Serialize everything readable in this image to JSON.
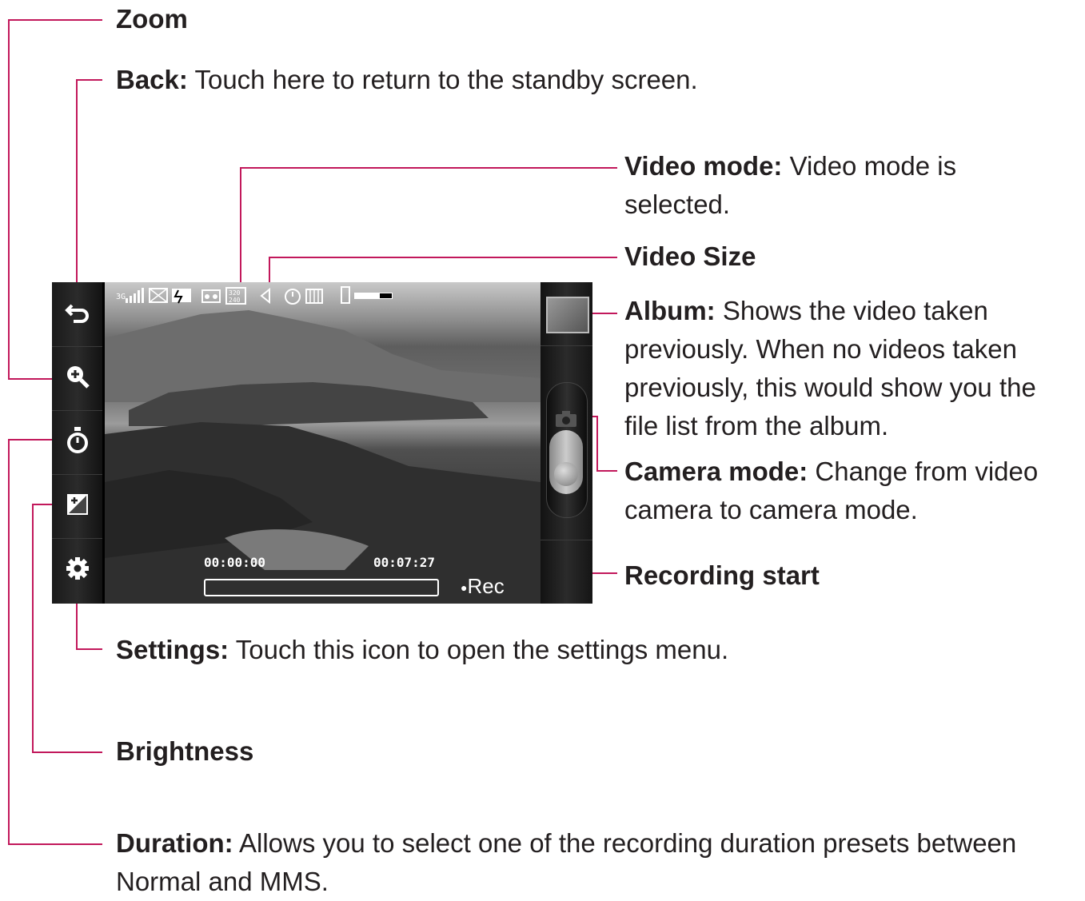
{
  "callouts": {
    "zoom": {
      "title": "Zoom",
      "desc": ""
    },
    "back": {
      "title": "Back:",
      "desc": " Touch here to return to the standby screen."
    },
    "video_mode": {
      "title": "Video mode:",
      "desc": " Video mode is selected."
    },
    "video_size": {
      "title": "Video Size",
      "desc": ""
    },
    "album": {
      "title": "Album:",
      "desc": " Shows the video taken previously. When no videos taken previously, this would show you the file list from the album."
    },
    "camera_mode": {
      "title": "Camera mode:",
      "desc": " Change from video camera to camera mode."
    },
    "recording_start": {
      "title": "Recording start",
      "desc": ""
    },
    "settings": {
      "title": "Settings:",
      "desc": " Touch this icon to open the settings menu."
    },
    "brightness": {
      "title": "Brightness",
      "desc": ""
    },
    "duration": {
      "title": "Duration:",
      "desc": " Allows you to select one of the recording duration presets between Normal and MMS."
    }
  },
  "screen": {
    "status_icons": [
      "3G",
      "signal-icon",
      "message-icon",
      "battery-icon",
      "video-mode-icon",
      "video-size-icon",
      "speaker-icon",
      "timer-icon",
      "storage-icon",
      "phone-memory-icon"
    ],
    "network_label": "3G",
    "video_size_value": "320 240",
    "elapsed_time": "00:00:00",
    "remaining_time": "00:07:27",
    "rec_label": "Rec",
    "left_buttons": [
      "back-icon",
      "zoom-icon",
      "duration-icon",
      "brightness-icon",
      "settings-icon"
    ]
  },
  "colors": {
    "leader": "#c2185b",
    "text": "#231f20"
  }
}
